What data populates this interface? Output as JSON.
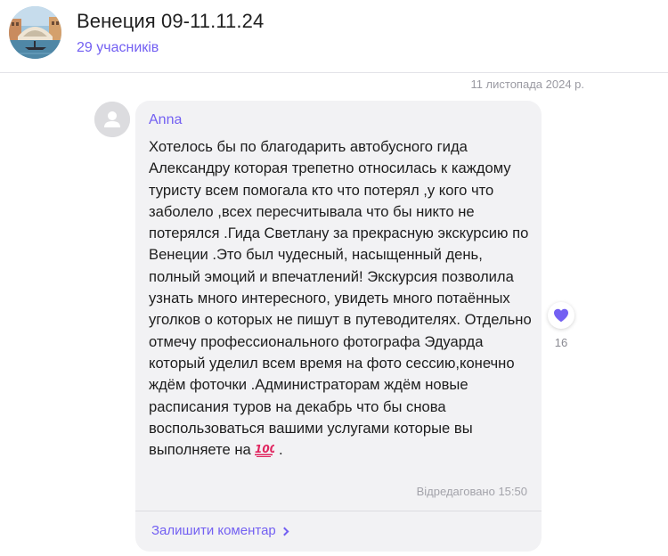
{
  "header": {
    "title": "Венеция 09-11.11.24",
    "members": "29 учасників",
    "avatar_icon": "venice-group-avatar"
  },
  "date_separator": "11 листопада 2024 р.",
  "message": {
    "author": "Anna",
    "avatar_icon": "user-placeholder-avatar",
    "text": "Хотелось бы по благодарить автобусного гида Александру которая трепетно относилась к каждому туристу всем помогала кто что потерял ,у кого что заболело ,всех пересчитывала что бы никто не потерялся .Гида Светлану  за прекрасную экскурсию по Венеции .Это был чудесный, насыщенный день, полный эмоций и впечатлений! Экскурсия позволила узнать много интересного, увидеть много потаённых уголков  о которых не пишут в путеводителях. Отдельно отмечу профессионального  фотографа Эдуарда  который уделил всем время на фото сессию,конечно ждём фоточки .Администраторам ждём новые расписания туров на декабрь что бы снова воспользоваться вашими услугами которые вы выполняете на",
    "text_end": " .",
    "emoji_icon": "hundred-points-emoji",
    "edited": "Відредаговано 15:50",
    "comment_link": "Залишити коментар"
  },
  "reaction": {
    "icon": "purple-heart-icon",
    "count": "16"
  },
  "colors": {
    "accent": "#7360f2",
    "bubble": "#f2f2f4",
    "muted": "#9a9aa2"
  }
}
